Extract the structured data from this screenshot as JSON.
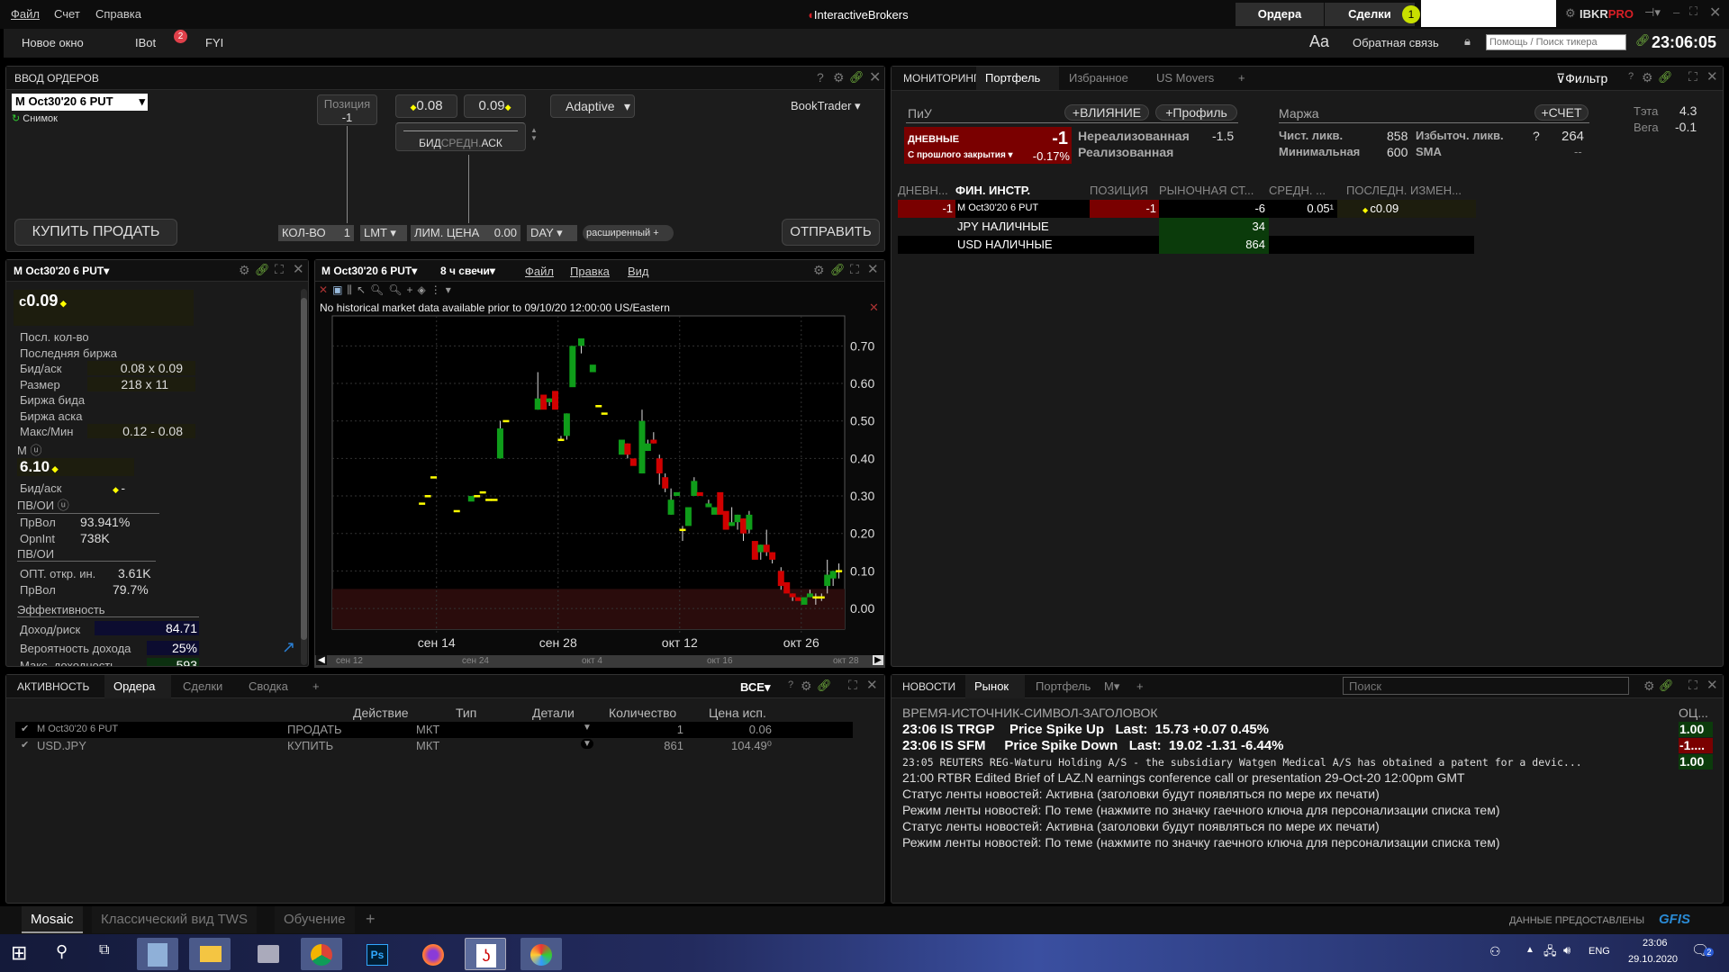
{
  "menu": {
    "items": [
      "Файл",
      "Счет",
      "Справка"
    ],
    "logo": "InteractiveBrokers",
    "orders_btn": "Ордера",
    "trades_btn": "Сделки",
    "trades_badge": "1",
    "brand": "IBKR",
    "brand_pro": "PRO"
  },
  "toolbar": {
    "new_window": "Новое окно",
    "ibot": "IBot",
    "ibot_badge": "2",
    "fyi": "FYI",
    "font": "Aa",
    "feedback": "Обратная связь",
    "search_placeholder": "Помощь / Поиск тикера",
    "time": "23:06:05"
  },
  "order_entry": {
    "title": "ВВОД ОРДЕРОВ",
    "symbol": "M Oct30'20 6 PUT",
    "snapshot": "Снимок",
    "position_label": "Позиция",
    "position_value": "-1",
    "bid": "0.08",
    "ask": "0.09",
    "slider_label_bid": "БИД",
    "slider_label_mid": "СРЕДН.",
    "slider_label_ask": "АСК",
    "algo": "Adaptive",
    "booktrader": "BookTrader",
    "buy": "КУПИТЬ",
    "sell": "ПРОДАТЬ",
    "qty_label": "КОЛ-ВО",
    "qty": "1",
    "order_type": "LMT",
    "limit_label": "ЛИМ. ЦЕНА",
    "limit": "0.00",
    "tif": "DAY",
    "advanced": "расширенный",
    "submit": "ОТПРАВИТЬ"
  },
  "quote": {
    "symbol": "M Oct30'20 6 PUT",
    "last": "0.09",
    "last_prefix": "c",
    "rows": [
      {
        "l": "Посл. кол-во",
        "v": ""
      },
      {
        "l": "Последняя биржа",
        "v": ""
      },
      {
        "l": "Бид/аск",
        "v": "0.08 x 0.09"
      },
      {
        "l": "Размер",
        "v": "218 x 11"
      },
      {
        "l": "Биржа бида",
        "v": ""
      },
      {
        "l": "Биржа аска",
        "v": ""
      },
      {
        "l": "Макс/Мин",
        "v": "0.12 - 0.08"
      }
    ],
    "underlying": "M",
    "underlying_price": "6.10",
    "u_bidask_label": "Бид/аск",
    "u_bidask": "-",
    "ivoi1": "ПВ/ОИ",
    "iv_label": "ПрВол",
    "iv": "93.941%",
    "oi_label": "OpnInt",
    "oi": "738K",
    "ivoi2": "ПВ/ОИ",
    "opt_oi_label": "ОПТ. откр. ин.",
    "opt_oi": "3.61K",
    "iv2_label": "ПрВол",
    "iv2": "79.7%",
    "perf": "Эффективность",
    "rr_label": "Доход/риск",
    "rr": "84.71",
    "pp_label": "Вероятность дохода",
    "pp": "25%",
    "mr_label": "Макс. доходность",
    "mr": "593"
  },
  "chart": {
    "symbol": "M Oct30'20 6 PUT",
    "period": "8 ч свечи",
    "menu": [
      "Файл",
      "Правка",
      "Вид"
    ],
    "notice": "No historical market data available prior to 09/10/20 12:00:00 US/Eastern",
    "nav_labels": [
      "сен 12",
      "сен 24",
      "окт 4",
      "окт 16",
      "окт 28"
    ]
  },
  "chart_data": {
    "type": "candlestick",
    "xlim": [
      "2020-09-02",
      "2020-10-31"
    ],
    "ylim": [
      -0.055,
      0.78
    ],
    "yticks": [
      "0.00",
      "0.10",
      "0.20",
      "0.30",
      "0.40",
      "0.50",
      "0.60",
      "0.70"
    ],
    "xticks": [
      {
        "d": "2020-09-14",
        "l": "сен 14"
      },
      {
        "d": "2020-09-28",
        "l": "сен 28"
      },
      {
        "d": "2020-10-12",
        "l": "окт 12"
      },
      {
        "d": "2020-10-26",
        "l": "окт 26"
      }
    ],
    "grid": true,
    "shaded_band": [
      -0.055,
      0.052
    ],
    "colors": {
      "up": "#0f9d1a",
      "down": "#d00000",
      "flat": "#ffff00"
    },
    "candles": [
      [
        "2020-09-12T08",
        0.28,
        0.28,
        0.28,
        0.28
      ],
      [
        "2020-09-13T00",
        0.3,
        0.3,
        0.3,
        0.3
      ],
      [
        "2020-09-13T16",
        0.35,
        0.35,
        0.35,
        0.35
      ],
      [
        "2020-09-16T08",
        0.26,
        0.26,
        0.26,
        0.26
      ],
      [
        "2020-09-18T00",
        0.285,
        0.3,
        0.285,
        0.3
      ],
      [
        "2020-09-18T16",
        0.3,
        0.3,
        0.3,
        0.3
      ],
      [
        "2020-09-19T08",
        0.31,
        0.31,
        0.31,
        0.31
      ],
      [
        "2020-09-20T00",
        0.29,
        0.29,
        0.29,
        0.29
      ],
      [
        "2020-09-20T16",
        0.29,
        0.29,
        0.29,
        0.29
      ],
      [
        "2020-09-21T08",
        0.4,
        0.5,
        0.4,
        0.48
      ],
      [
        "2020-09-22T00",
        0.5,
        0.5,
        0.5,
        0.5
      ],
      [
        "2020-09-25T16",
        0.53,
        0.63,
        0.53,
        0.56
      ],
      [
        "2020-09-26T08",
        0.57,
        0.57,
        0.53,
        0.53
      ],
      [
        "2020-09-27T00",
        0.55,
        0.56,
        0.54,
        0.56
      ],
      [
        "2020-09-27T16",
        0.58,
        0.58,
        0.53,
        0.53
      ],
      [
        "2020-09-28T08",
        0.45,
        0.46,
        0.45,
        0.45
      ],
      [
        "2020-09-29T00",
        0.46,
        0.52,
        0.45,
        0.52
      ],
      [
        "2020-09-29T16",
        0.59,
        0.7,
        0.59,
        0.7
      ],
      [
        "2020-09-30T16",
        0.7,
        0.72,
        0.68,
        0.72
      ],
      [
        "2020-10-02T00",
        0.63,
        0.65,
        0.63,
        0.65
      ],
      [
        "2020-10-02T16",
        0.54,
        0.54,
        0.54,
        0.54
      ],
      [
        "2020-10-03T08",
        0.52,
        0.52,
        0.52,
        0.52
      ],
      [
        "2020-10-05T08",
        0.41,
        0.45,
        0.41,
        0.45
      ],
      [
        "2020-10-06T00",
        0.44,
        0.44,
        0.4,
        0.41
      ],
      [
        "2020-10-06T16",
        0.4,
        0.4,
        0.38,
        0.38
      ],
      [
        "2020-10-07T16",
        0.36,
        0.53,
        0.36,
        0.5
      ],
      [
        "2020-10-08T08",
        0.42,
        0.45,
        0.42,
        0.44
      ],
      [
        "2020-10-09T00",
        0.45,
        0.47,
        0.44,
        0.44
      ],
      [
        "2020-10-09T16",
        0.4,
        0.41,
        0.33,
        0.36
      ],
      [
        "2020-10-10T08",
        0.35,
        0.36,
        0.31,
        0.32
      ],
      [
        "2020-10-11T00",
        0.25,
        0.32,
        0.25,
        0.29
      ],
      [
        "2020-10-11T16",
        0.3,
        0.31,
        0.3,
        0.31
      ],
      [
        "2020-10-12T08",
        0.21,
        0.22,
        0.18,
        0.21
      ],
      [
        "2020-10-13T00",
        0.22,
        0.27,
        0.22,
        0.27
      ],
      [
        "2020-10-13T16",
        0.3,
        0.35,
        0.3,
        0.34
      ],
      [
        "2020-10-14T08",
        0.31,
        0.31,
        0.3,
        0.3
      ],
      [
        "2020-10-15T08",
        0.27,
        0.29,
        0.27,
        0.28
      ],
      [
        "2020-10-16T00",
        0.25,
        0.27,
        0.25,
        0.27
      ],
      [
        "2020-10-16T16",
        0.31,
        0.31,
        0.25,
        0.25
      ],
      [
        "2020-10-17T08",
        0.26,
        0.26,
        0.21,
        0.21
      ],
      [
        "2020-10-18T00",
        0.22,
        0.27,
        0.22,
        0.23
      ],
      [
        "2020-10-18T16",
        0.23,
        0.25,
        0.21,
        0.25
      ],
      [
        "2020-10-19T08",
        0.24,
        0.24,
        0.18,
        0.2
      ],
      [
        "2020-10-20T00",
        0.21,
        0.26,
        0.2,
        0.25
      ],
      [
        "2020-10-20T16",
        0.18,
        0.18,
        0.13,
        0.13
      ],
      [
        "2020-10-21T08",
        0.15,
        0.17,
        0.13,
        0.17
      ],
      [
        "2020-10-22T00",
        0.17,
        0.21,
        0.14,
        0.15
      ],
      [
        "2020-10-22T16",
        0.15,
        0.15,
        0.12,
        0.13
      ],
      [
        "2020-10-23T16",
        0.1,
        0.11,
        0.05,
        0.06
      ],
      [
        "2020-10-24T08",
        0.07,
        0.07,
        0.04,
        0.04
      ],
      [
        "2020-10-25T00",
        0.04,
        0.04,
        0.02,
        0.03
      ],
      [
        "2020-10-25T16",
        0.03,
        0.03,
        0.02,
        0.02
      ],
      [
        "2020-10-26T08",
        0.01,
        0.03,
        0.01,
        0.03
      ],
      [
        "2020-10-27T00",
        0.03,
        0.05,
        0.03,
        0.04
      ],
      [
        "2020-10-27T16",
        0.03,
        0.04,
        0.01,
        0.03
      ],
      [
        "2020-10-28T08",
        0.03,
        0.04,
        0.02,
        0.03
      ],
      [
        "2020-10-29T00",
        0.06,
        0.13,
        0.04,
        0.09
      ],
      [
        "2020-10-29T16",
        0.08,
        0.1,
        0.06,
        0.1
      ],
      [
        "2020-10-30T08",
        0.1,
        0.12,
        0.08,
        0.1
      ]
    ]
  },
  "portfolio": {
    "tabs": [
      "МОНИТОРИНГ",
      "Портфель",
      "Избранное",
      "US Movers"
    ],
    "filter": "Фильтр",
    "pnl": "ПиУ",
    "impact_btn": "ВЛИЯНИЕ",
    "profile_btn": "Профиль",
    "daily": "ДНЕВНЫЕ",
    "daily_value": "-1",
    "since_close": "С прошлого закрытия",
    "since_close_pct": "-0.17%",
    "unrealized_label": "Нереализованная",
    "unrealized": "-1.5",
    "realized_label": "Реализованная",
    "margin": "Маржа",
    "account_btn": "СЧЕТ",
    "net_liq_label": "Чист. ликв.",
    "net_liq": "858",
    "excess_label": "Избыточ. ликв.",
    "excess_q": "?",
    "excess": "264",
    "min_label": "Минимальная",
    "min": "600",
    "sma": "SMA",
    "sma_value": "--",
    "theta_label": "Тэта",
    "theta": "4.3",
    "vega_label": "Вега",
    "vega": "-0.1",
    "columns": [
      "ДНЕВН...",
      "ФИН. ИНСТР.",
      "ПОЗИЦИЯ",
      "РЫНОЧНАЯ СТ...",
      "СРЕДН. ...",
      "ПОСЛЕДН. ИЗМЕН..."
    ],
    "rows": [
      {
        "daily": "-1",
        "instr": "M Oct30'20 6 PUT",
        "pos": "-1",
        "mkt": "-6",
        "avg": "0.05¹",
        "last": "c0.09"
      },
      {
        "daily": "",
        "instr": "JPY НАЛИЧНЫЕ",
        "pos": "",
        "mkt": "34",
        "avg": "",
        "last": ""
      },
      {
        "daily": "",
        "instr": "USD НАЛИЧНЫЕ",
        "pos": "",
        "mkt": "864",
        "avg": "",
        "last": ""
      }
    ]
  },
  "activity": {
    "tabs": [
      "АКТИВНОСТЬ",
      "Ордера",
      "Сделки",
      "Сводка"
    ],
    "filter": "ВСЕ",
    "columns": [
      "Действие",
      "Тип",
      "Детали",
      "Количество",
      "Цена исп."
    ],
    "rows": [
      {
        "symbol": "M Oct30'20 6 PUT",
        "action": "ПРОДАТЬ",
        "type": "МКТ",
        "qty": "1",
        "price": "0.06"
      },
      {
        "symbol": "USD.JPY",
        "action": "КУПИТЬ",
        "type": "МКТ",
        "qty": "861",
        "price": "104.49⁰"
      }
    ]
  },
  "news": {
    "tabs": [
      "НОВОСТИ",
      "Рынок",
      "Портфель",
      "M"
    ],
    "search_placeholder": "Поиск",
    "header": "ВРЕМЯ-ИСТОЧНИК-СИМВОЛ-ЗАГОЛОВОК",
    "score_header": "ОЦ...",
    "items": [
      {
        "text": "23:06 IS TRGP    Price Spike Up   Last:  15.73 +0.07 0.45%",
        "score": "1.00",
        "bold": true,
        "tone": "pos"
      },
      {
        "text": "23:06 IS SFM     Price Spike Down   Last:  19.02 -1.31 -6.44%",
        "score": "-1....",
        "bold": true,
        "tone": "neg"
      },
      {
        "text": "23:05 REUTERS REG-Waturu Holding A/S - the subsidiary Watgen Medical A/S has obtained a patent for a devic...",
        "score": "1.00",
        "mono": true,
        "tone": "pos"
      },
      {
        "text": "21:00 RTBR Edited Brief of LAZ.N earnings conference call or presentation 29-Oct-20 12:00pm GMT",
        "score": ""
      },
      {
        "text": "Статус ленты новостей: Активна (заголовки будут появляться по мере их печати)",
        "score": ""
      },
      {
        "text": "Режим ленты новостей: По теме (нажмите по значку гаечного ключа для персонализации списка тем)",
        "score": ""
      },
      {
        "text": "Статус ленты новостей: Активна (заголовки будут появляться по мере их печати)",
        "score": ""
      },
      {
        "text": "Режим ленты новостей: По теме (нажмите по значку гаечного ключа для персонализации списка тем)",
        "score": ""
      }
    ]
  },
  "layouts": {
    "tabs": [
      "Mosaic",
      "Классический вид TWS",
      "Обучение"
    ],
    "data_by": "ДАННЫЕ ПРЕДОСТАВЛЕНЫ",
    "gfis": "GFIS"
  },
  "taskbar": {
    "time": "23:06",
    "date": "29.10.2020",
    "lang": "ENG",
    "notif": "2",
    "apps": [
      "calculator",
      "file-explorer",
      "system-monitor",
      "chrome",
      "photoshop",
      "firefox",
      "tws",
      "paint"
    ]
  }
}
